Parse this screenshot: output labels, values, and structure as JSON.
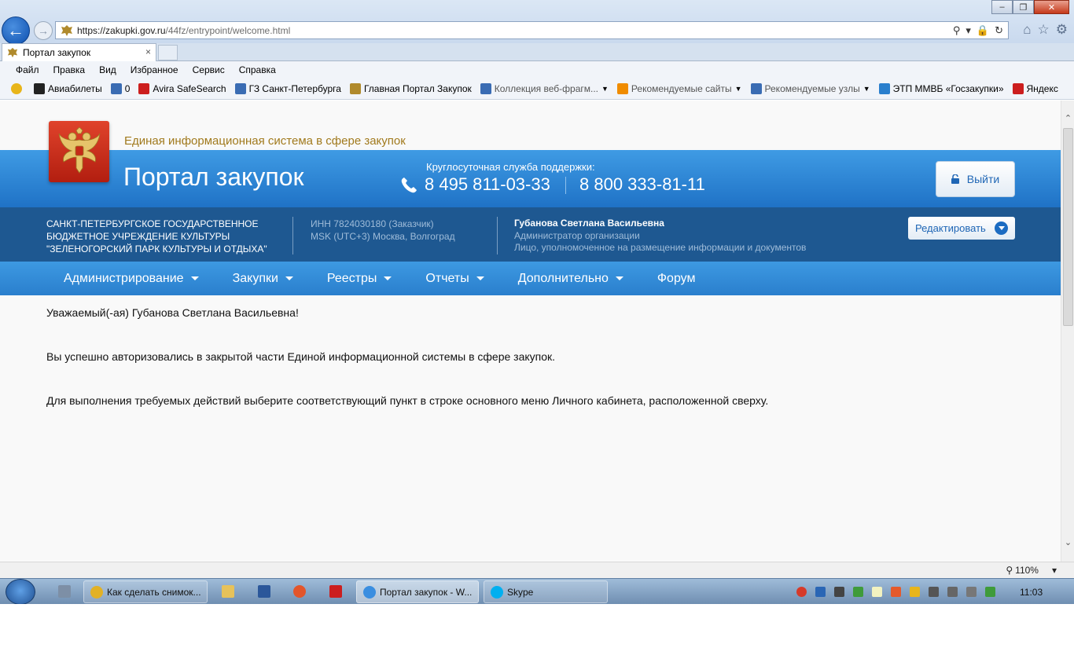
{
  "browser": {
    "url_host": "https://zakupki.gov.ru",
    "url_path": "/44fz/entrypoint/welcome.html",
    "tab_title": "Портал закупок",
    "tab_close": "×",
    "menu": [
      "Файл",
      "Правка",
      "Вид",
      "Избранное",
      "Сервис",
      "Справка"
    ],
    "favorites": [
      {
        "label": "Авиабилеты",
        "color": "#222222"
      },
      {
        "label": "0",
        "color": "#3a6cb3"
      },
      {
        "label": "Avira SafeSearch",
        "color": "#cc1e1e"
      },
      {
        "label": "ГЗ Санкт-Петербурга",
        "color": "#3a6cb3"
      },
      {
        "label": "Главная Портал Закупок",
        "color": "#b08a2c"
      },
      {
        "label": "Коллекция веб-фрагм...",
        "color": "#3a6cb3",
        "dropdown": true,
        "dim": true
      },
      {
        "label": "Рекомендуемые сайты",
        "color": "#f08c00",
        "dropdown": true,
        "dim": true
      },
      {
        "label": "Рекомендуемые узлы",
        "color": "#3a6cb3",
        "dropdown": true,
        "dim": true
      },
      {
        "label": "ЭТП ММВБ «Госзакупки»",
        "color": "#2a7fcd"
      },
      {
        "label": "Яндекс",
        "color": "#cc1e1e"
      }
    ],
    "zoom": "110%"
  },
  "site": {
    "tagline": "Единая информационная система в сфере закупок",
    "title": "Портал закупок",
    "support_label": "Круглосуточная служба поддержки:",
    "phone1": "8 495 811-03-33",
    "phone2": "8 800 333-81-11",
    "logout_label": "Выйти",
    "org_name": "САНКТ-ПЕТЕРБУРГСКОЕ ГОСУДАРСТВЕННОЕ БЮДЖЕТНОЕ УЧРЕЖДЕНИЕ КУЛЬТУРЫ \"ЗЕЛЕНОГОРСКИЙ ПАРК КУЛЬТУРЫ И ОТДЫХА\"",
    "inn": "ИНН 7824030180 (Заказчик)",
    "timezone": "MSK (UTC+3) Москва, Волгоград",
    "user_name": "Губанова Светлана Васильевна",
    "user_role": "Администратор организации",
    "user_authority": "Лицо, уполномоченное на размещение информации и документов",
    "edit_label": "Редактировать",
    "nav": [
      {
        "label": "Администрирование",
        "dropdown": true
      },
      {
        "label": "Закупки",
        "dropdown": true
      },
      {
        "label": "Реестры",
        "dropdown": true
      },
      {
        "label": "Отчеты",
        "dropdown": true
      },
      {
        "label": "Дополнительно",
        "dropdown": true
      },
      {
        "label": "Форум",
        "dropdown": false
      }
    ],
    "greeting": "Уважаемый(-ая) Губанова Светлана Васильевна!",
    "message1": "Вы успешно авторизовались в закрытой части Единой информационной системы в сфере закупок.",
    "message2": "Для выполнения требуемых действий выберите соответствующий пункт в строке основного меню Личного кабинета, расположенной сверху."
  },
  "taskbar": {
    "items": [
      {
        "label": "Как сделать снимок...",
        "active": false
      },
      {
        "label": "Портал закупок - W...",
        "active": true
      },
      {
        "label": "Skype",
        "active": false
      }
    ],
    "clock": "11:03"
  },
  "colors": {
    "header_blue": "#2a7fcd",
    "org_band": "#1e5891",
    "tagline_gold": "#a17a1d",
    "emblem_red": "#c42a18"
  }
}
